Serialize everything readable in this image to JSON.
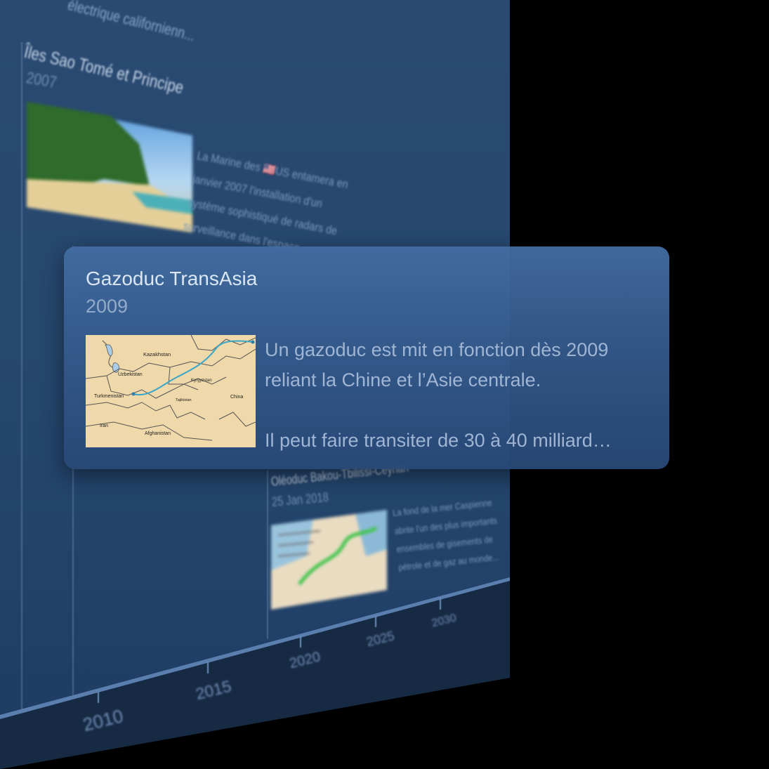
{
  "background_timeline": {
    "top_fragment": "électrique californienn...",
    "event_1": {
      "title": "Îles Sao Tomé et Principe",
      "year": "2007",
      "desc_lines": [
        "La Marine des 🇺🇸US entamera en",
        "janvier 2007 l'installation d'un",
        "système sophistiqué de radars de",
        "surveillance dans l'espace..."
      ]
    },
    "event_2": {
      "title": "Oléoduc Bakou-Tbilissi-Ceyhan",
      "year": "25 Jan 2018",
      "desc_lines": [
        "La fond de la mer Caspienne",
        "abrite l'un des plus importants",
        "ensembles de gisements de",
        "pétrole et de gaz au monde..."
      ]
    },
    "axis_labels": [
      "2010",
      "2015",
      "2020",
      "2025",
      "2030"
    ]
  },
  "card": {
    "title": "Gazoduc TransAsia",
    "year": "2009",
    "desc_1": "Un gazoduc est mit en fonction dès 2009 reliant la Chine et l’Asie centrale.",
    "desc_2": "Il peut faire transiter de 30 à 40 milliard…",
    "map_labels": {
      "kazakhstan": "Kazakhstan",
      "uzbekistan": "Uzbekistan",
      "kyrgyzstan": "Kyrgyzstan",
      "turkmenistan": "Turkmenistan",
      "tajikistan": "Tajikistan",
      "china": "China",
      "iran": "Iran",
      "afghanistan": "Afghanistan"
    }
  },
  "colors": {
    "background": "#000000",
    "panel": "#26476e",
    "card": "#3f679a",
    "pipeline": "#3aa7c9"
  }
}
